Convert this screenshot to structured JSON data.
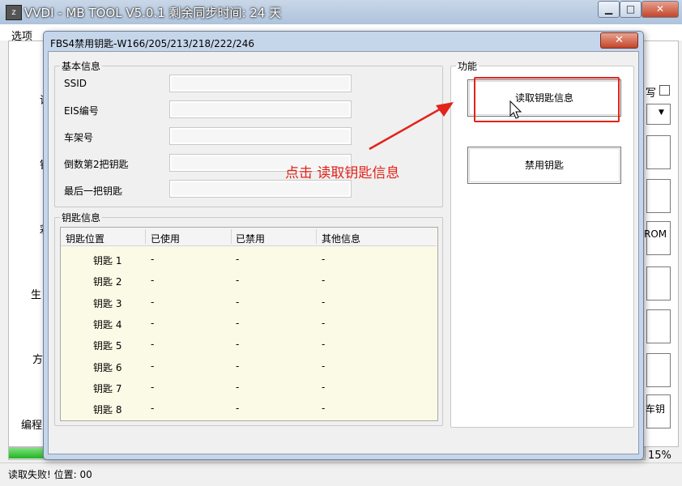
{
  "main_window": {
    "title": "VVDI - MB TOOL V5.0.1   剩余同步时间: 24 天",
    "app_icon_glyph": "z",
    "caption_buttons": {
      "minimize": "▁",
      "maximize": "□",
      "close": "✕"
    },
    "menu_first": "选项",
    "side_labels": [
      "读",
      "钥",
      "彩",
      "生",
      "方",
      "编程"
    ],
    "right_partial": {
      "checkbox_label": "写",
      "rom_label": "ROM",
      "key_label": "车钥"
    },
    "progress": {
      "percent_text": "15%",
      "value": 0.15
    },
    "status": "读取失败! 位置: 00"
  },
  "dialog": {
    "title": "FBS4禁用钥匙-W166/205/213/218/222/246",
    "close_label": "✕",
    "basic_info": {
      "legend": "基本信息",
      "fields": [
        {
          "label": "SSID",
          "value": ""
        },
        {
          "label": "EIS编号",
          "value": ""
        },
        {
          "label": "车架号",
          "value": ""
        },
        {
          "label": "倒数第2把钥匙",
          "value": ""
        },
        {
          "label": "最后一把钥匙",
          "value": ""
        }
      ]
    },
    "key_info": {
      "legend": "钥匙信息",
      "columns": [
        "钥匙位置",
        "已使用",
        "已禁用",
        "其他信息"
      ],
      "rows": [
        [
          "钥匙 1",
          "-",
          "-",
          "-"
        ],
        [
          "钥匙 2",
          "-",
          "-",
          "-"
        ],
        [
          "钥匙 3",
          "-",
          "-",
          "-"
        ],
        [
          "钥匙 4",
          "-",
          "-",
          "-"
        ],
        [
          "钥匙 5",
          "-",
          "-",
          "-"
        ],
        [
          "钥匙 6",
          "-",
          "-",
          "-"
        ],
        [
          "钥匙 7",
          "-",
          "-",
          "-"
        ],
        [
          "钥匙 8",
          "-",
          "-",
          "-"
        ]
      ]
    },
    "function": {
      "legend": "功能",
      "read_key_info_label": "读取钥匙信息",
      "disable_key_label": "禁用钥匙"
    }
  },
  "annotation": {
    "text": "点击 读取钥匙信息",
    "color": "#e2231a"
  }
}
